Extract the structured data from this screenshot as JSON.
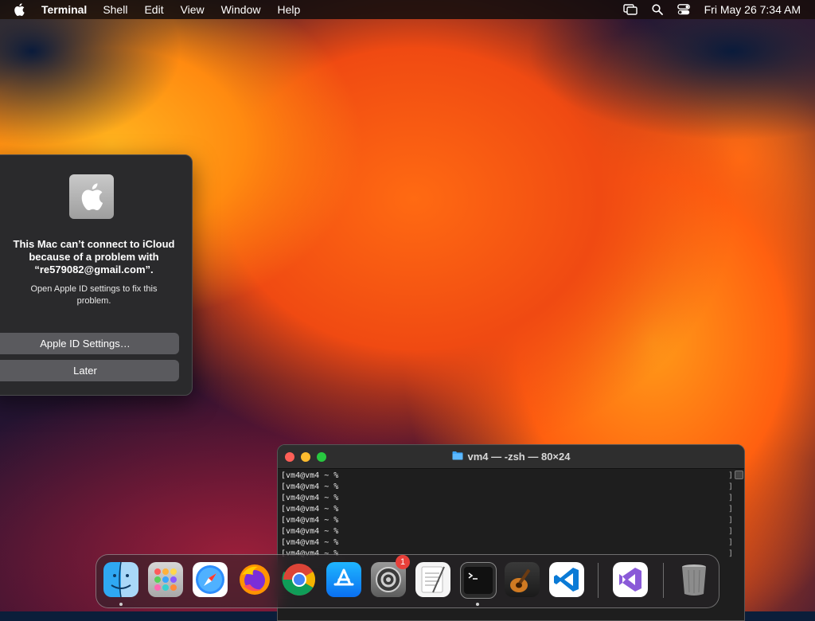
{
  "menubar": {
    "app_name": "Terminal",
    "menus": [
      "Shell",
      "Edit",
      "View",
      "Window",
      "Help"
    ],
    "clock": "Fri May 26  7:34 AM"
  },
  "alert": {
    "title": "This Mac can’t connect to iCloud because of a problem with “re579082@gmail.com”.",
    "message": "Open Apple ID settings to fix this problem.",
    "primary_button": "Apple ID Settings…",
    "secondary_button": "Later"
  },
  "terminal": {
    "title": "vm4 — -zsh — 80×24",
    "prompt": "vm4@vm4 ~ %",
    "lines": [
      "vm4@vm4 ~ %",
      "vm4@vm4 ~ %",
      "vm4@vm4 ~ %",
      "vm4@vm4 ~ %",
      "vm4@vm4 ~ %",
      "vm4@vm4 ~ %",
      "vm4@vm4 ~ %",
      "vm4@vm4 ~ %"
    ]
  },
  "dock": {
    "apps": [
      "finder-icon",
      "launchpad-icon",
      "safari-icon",
      "firefox-icon",
      "chrome-icon",
      "app-store-icon",
      "system-preferences-icon",
      "textedit-icon",
      "terminal-icon",
      "garageband-icon",
      "vscode-icon",
      "visual-studio-icon",
      "trash-icon"
    ],
    "system_preferences_badge": "1"
  },
  "colors": {
    "close": "#fe5f57",
    "minimize": "#febc2e",
    "zoom": "#28c840",
    "alert_bg": "#2a2a2c",
    "button_bg": "#5a5a5e"
  }
}
